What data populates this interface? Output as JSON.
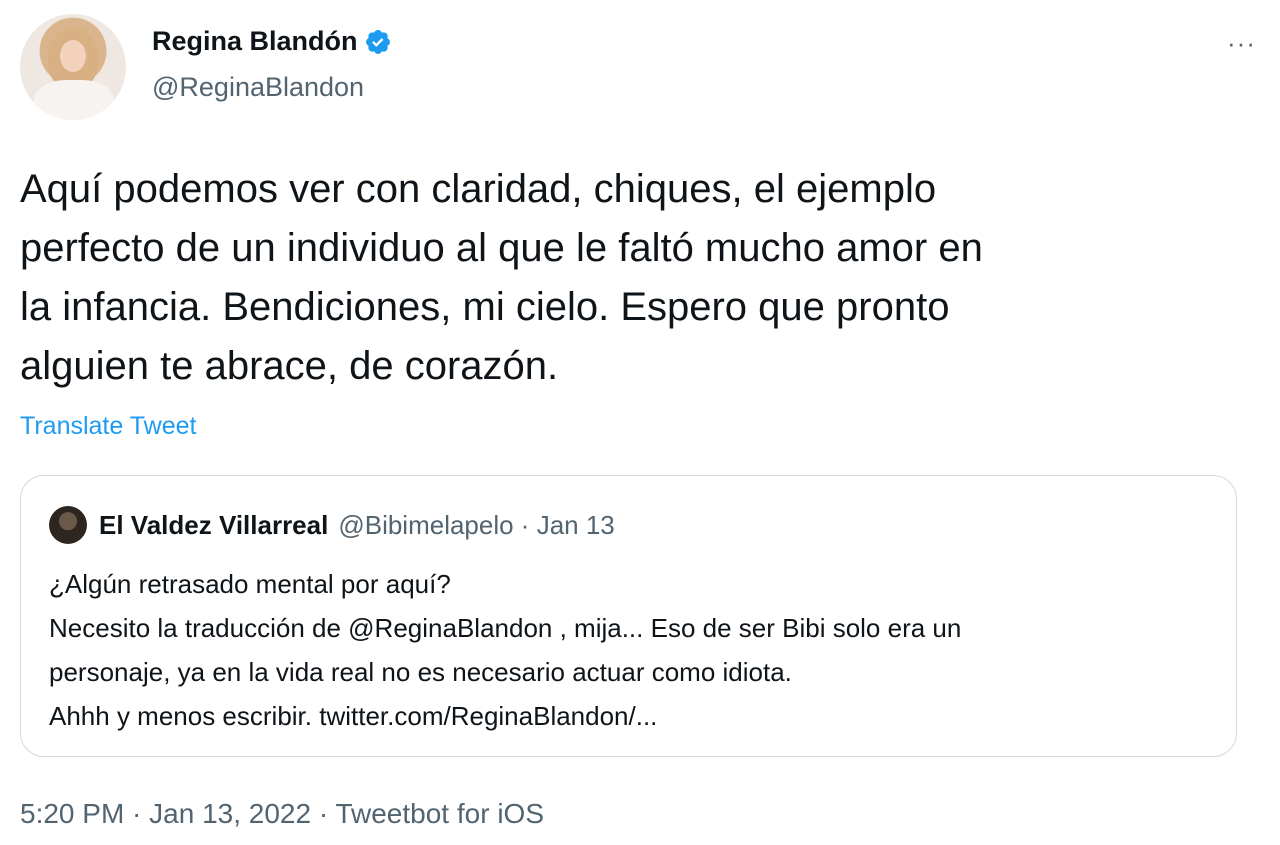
{
  "author": {
    "name": "Regina Blandón",
    "handle": "@ReginaBlandon"
  },
  "more_icon": "···",
  "tweet": {
    "text": "Aquí podemos ver con claridad, chiques, el ejemplo\nperfecto de un individuo al que le faltó mucho amor en\nla infancia. Bendiciones, mi cielo. Espero que pronto\nalguien te abrace, de corazón.",
    "translate_label": "Translate Tweet"
  },
  "quoted": {
    "name": "El Valdez Villarreal",
    "handle_date": "@Bibimelapelo · Jan 13",
    "text": "¿Algún retrasado mental por aquí?\nNecesito la traducción de @ReginaBlandon , mija... Eso de ser Bibi solo era un\npersonaje, ya en la vida real no es necesario actuar como idiota.\nAhhh y menos escribir. twitter.com/ReginaBlandon/..."
  },
  "meta": "5:20 PM · Jan 13, 2022 · Tweetbot for iOS",
  "colors": {
    "link": "#1d9bf0",
    "secondary_text": "#536471",
    "verified_badge": "#1d9bf0"
  }
}
